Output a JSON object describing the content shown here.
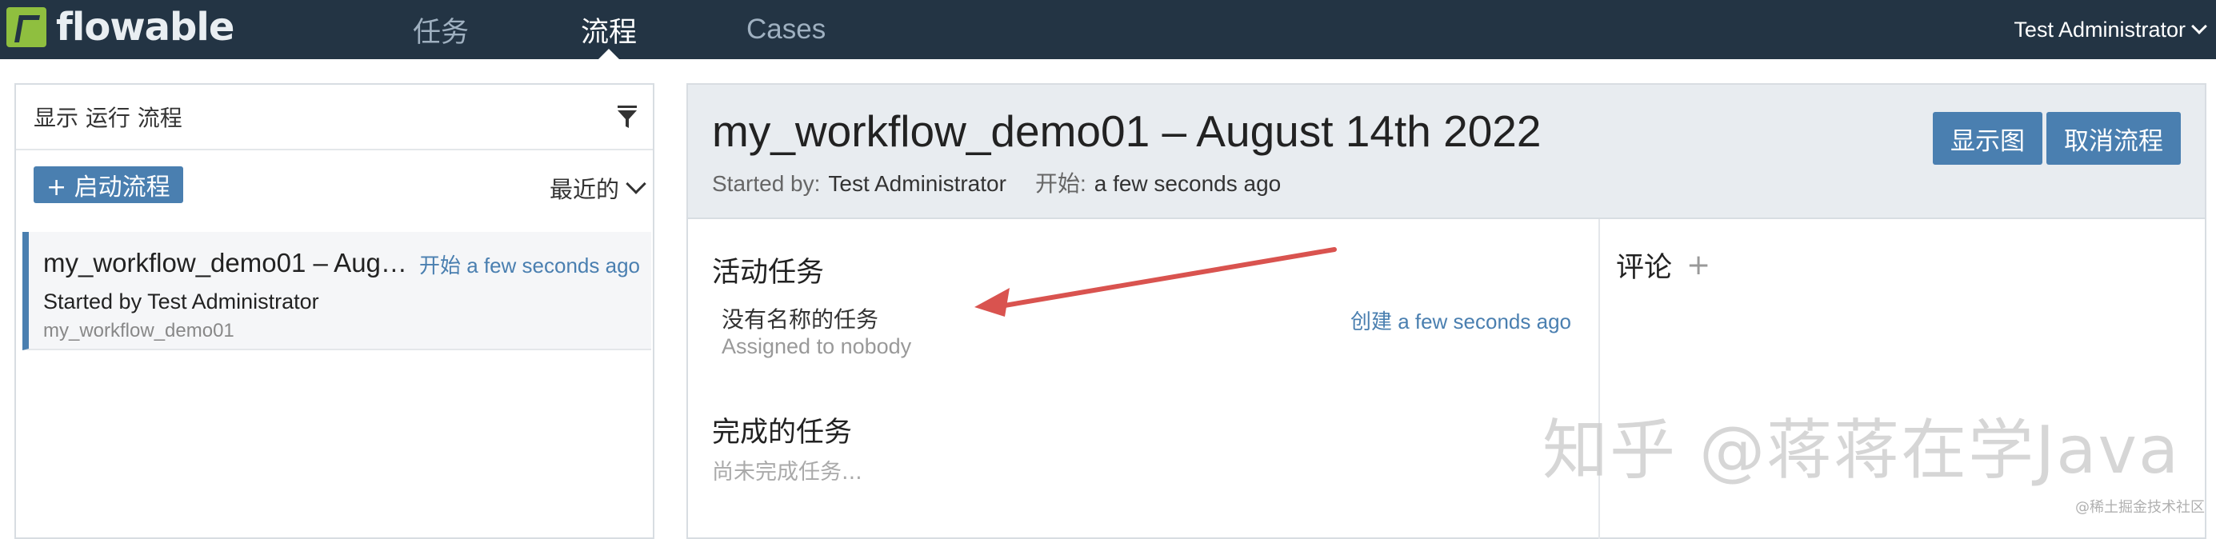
{
  "brand": {
    "name": "flowable"
  },
  "nav": {
    "tasks": "任务",
    "processes": "流程",
    "cases": "Cases"
  },
  "user": {
    "name": "Test Administrator"
  },
  "left_panel": {
    "header": "显示 运行 流程",
    "start_button": "+ 启动流程",
    "sort_label": "最近的",
    "items": [
      {
        "name": "my_workflow_demo01 – Aug…",
        "start_label": "开始",
        "start_time": "a few seconds ago",
        "started_by": "Started by Test Administrator",
        "key": "my_workflow_demo01"
      }
    ]
  },
  "detail": {
    "title": "my_workflow_demo01 – August 14th 2022",
    "started_by_label": "Started by:",
    "started_by": "Test Administrator",
    "start_label": "开始:",
    "start_time": "a few seconds ago",
    "show_diagram_button": "显示图",
    "cancel_button": "取消流程",
    "active_tasks_title": "活动任务",
    "task": {
      "name": "没有名称的任务",
      "assignee": "Assigned to nobody",
      "created_label": "创建",
      "created_time": "a few seconds ago"
    },
    "completed_tasks_title": "完成的任务",
    "completed_empty": "尚未完成任务...",
    "comments_title": "评论",
    "add_comment": "+"
  },
  "watermark": "知乎 @蒋蒋在学Java",
  "credit": "@稀土掘金技术社区",
  "colors": {
    "topbar": "#233444",
    "accent": "#4a7fb0",
    "logo": "#8fbf3f",
    "arrow": "#d9534f"
  }
}
